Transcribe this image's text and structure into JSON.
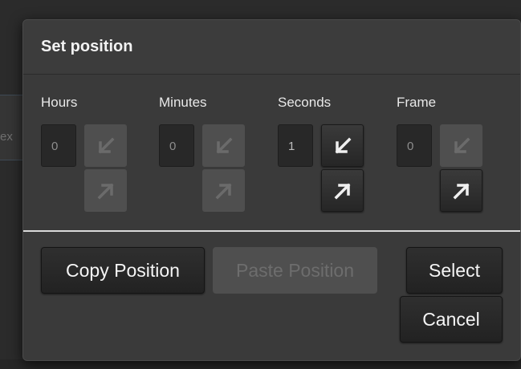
{
  "background": {
    "partial_text": "ex"
  },
  "dialog": {
    "title": "Set position",
    "fields": [
      {
        "label": "Hours",
        "value": "0",
        "down_enabled": false,
        "up_enabled": false
      },
      {
        "label": "Minutes",
        "value": "0",
        "down_enabled": false,
        "up_enabled": false
      },
      {
        "label": "Seconds",
        "value": "1",
        "down_enabled": true,
        "up_enabled": true
      },
      {
        "label": "Frame",
        "value": "0",
        "down_enabled": false,
        "up_enabled": true
      }
    ],
    "buttons": {
      "copy": "Copy Position",
      "paste": "Paste Position",
      "select": "Select",
      "cancel": "Cancel"
    }
  },
  "icons": {
    "down": "arrow-down-left-icon",
    "up": "arrow-up-right-icon"
  },
  "colors": {
    "dialog_bg": "#3a3a3a",
    "button_dark": "#262626",
    "button_disabled": "#4f4f4f",
    "divider": "#d9d9d9"
  }
}
